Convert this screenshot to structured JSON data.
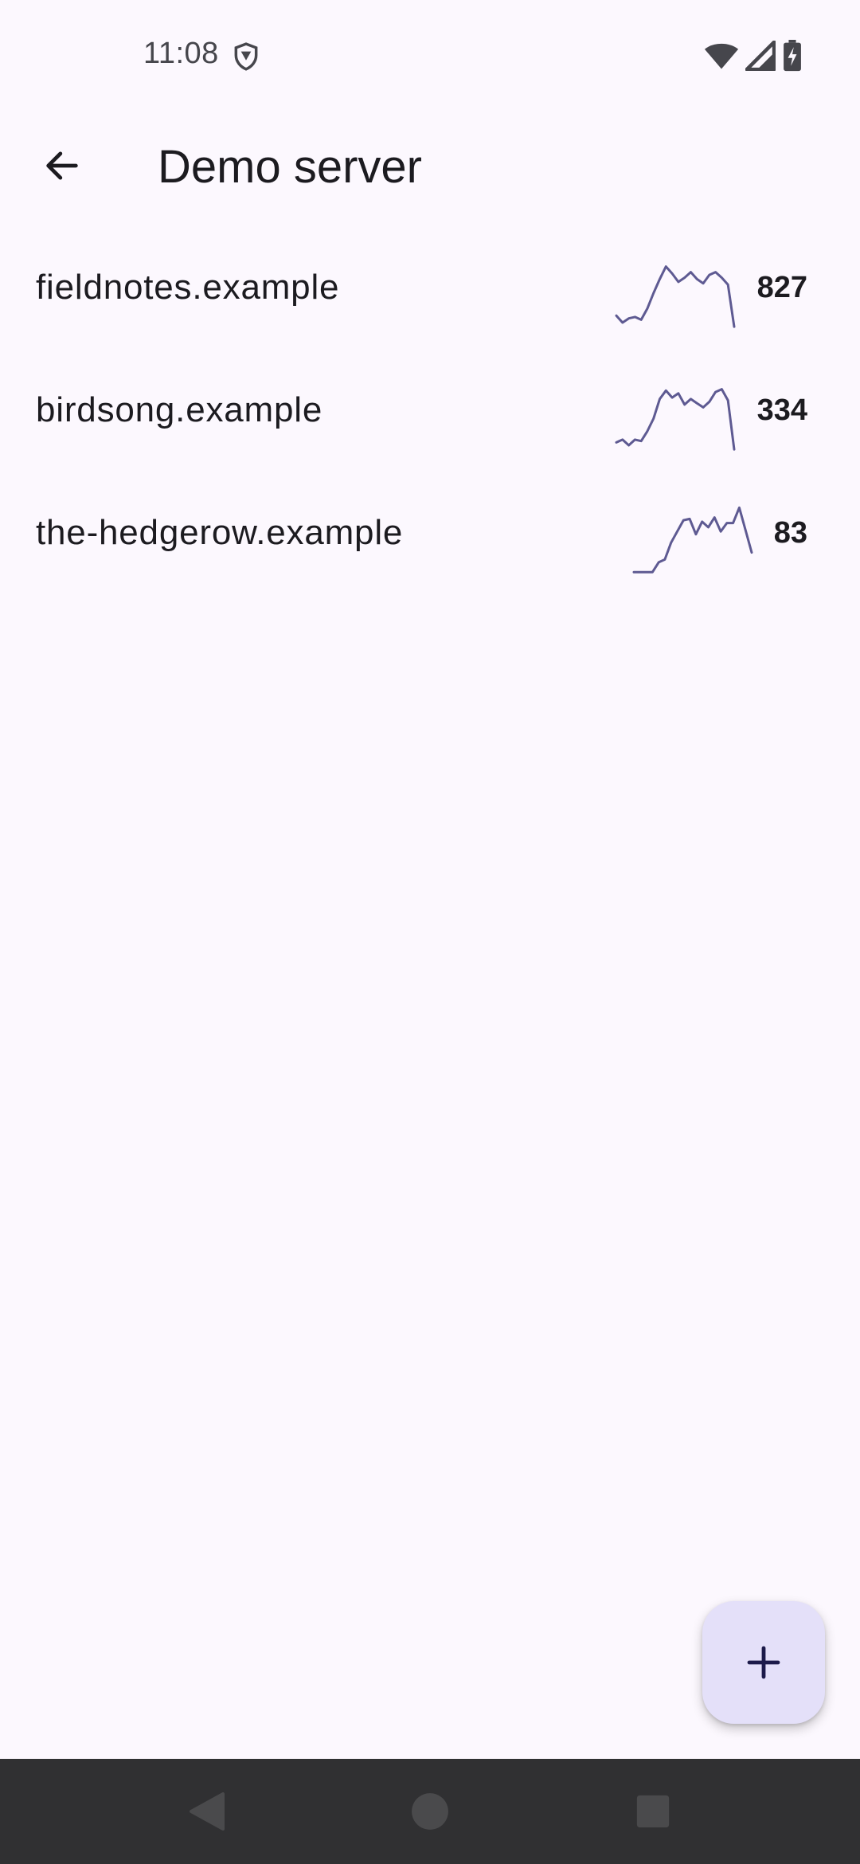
{
  "status_bar": {
    "time": "11:08",
    "icons": [
      "shield-icon",
      "wifi-icon",
      "cellular-signal-icon",
      "battery-charging-icon"
    ]
  },
  "app_bar": {
    "back_icon": "arrow-back-icon",
    "title": "Demo server"
  },
  "servers": [
    {
      "name": "fieldnotes.example",
      "count": "827",
      "sparkline": [
        0.18,
        0.08,
        0.14,
        0.16,
        0.12,
        0.28,
        0.5,
        0.7,
        0.88,
        0.78,
        0.66,
        0.72,
        0.8,
        0.7,
        0.64,
        0.76,
        0.8,
        0.72,
        0.62,
        0.02
      ]
    },
    {
      "name": "birdsong.example",
      "count": "334",
      "sparkline": [
        0.12,
        0.16,
        0.08,
        0.16,
        0.14,
        0.28,
        0.46,
        0.74,
        0.86,
        0.76,
        0.82,
        0.66,
        0.74,
        0.68,
        0.62,
        0.7,
        0.84,
        0.88,
        0.72,
        0.02
      ]
    },
    {
      "name": "the-hedgerow.example",
      "count": "83",
      "sparkline": [
        0.02,
        0.02,
        0.02,
        0.02,
        0.16,
        0.2,
        0.44,
        0.6,
        0.76,
        0.78,
        0.56,
        0.74,
        0.66,
        0.8,
        0.6,
        0.72,
        0.72,
        0.94,
        0.62,
        0.3
      ]
    }
  ],
  "fab": {
    "icon": "plus-icon"
  },
  "nav_bar": {
    "icons": [
      "back-triangle-icon",
      "home-circle-icon",
      "recents-square-icon"
    ]
  },
  "colors": {
    "background": "#fcf8fe",
    "sparkline": "#5e5a92",
    "fab_background": "#e4e0f9",
    "nav_background": "#303032"
  }
}
